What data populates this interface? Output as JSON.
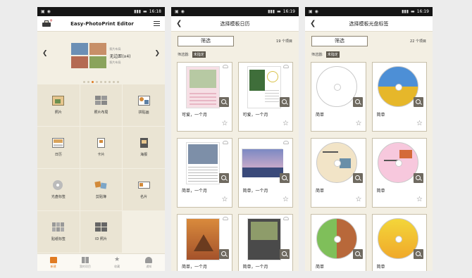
{
  "status": {
    "screens": [
      {
        "time": "16:18"
      },
      {
        "time": "16:19"
      },
      {
        "time": "16:19"
      }
    ]
  },
  "home": {
    "title": "Easy-PhotoPrint Editor",
    "banner": {
      "small_top": "照片布局",
      "main": "无边距(x4)",
      "small_bottom": "照片布局"
    },
    "dots_count": 9,
    "tiles": [
      {
        "label": "照片",
        "icon": "photo-icon"
      },
      {
        "label": "照片布局",
        "icon": "photo-layout-icon"
      },
      {
        "label": "拼贴画",
        "icon": "collage-icon"
      },
      {
        "label": "日历",
        "icon": "calendar-icon"
      },
      {
        "label": "卡片",
        "icon": "card-icon"
      },
      {
        "label": "海报",
        "icon": "poster-icon"
      },
      {
        "label": "光盘标签",
        "icon": "disc-label-icon"
      },
      {
        "label": "剪贴簿",
        "icon": "scrapbook-icon"
      },
      {
        "label": "名片",
        "icon": "business-card-icon"
      },
      {
        "label": "贴纸标签",
        "icon": "sticker-icon"
      },
      {
        "label": "ID 照片",
        "icon": "id-photo-icon"
      }
    ],
    "tabs": [
      {
        "label": "新建",
        "icon": "new-icon",
        "active": true
      },
      {
        "label": "我的项目",
        "icon": "my-projects-icon",
        "active": false
      },
      {
        "label": "收藏",
        "icon": "favorites-icon",
        "active": false
      },
      {
        "label": "通知",
        "icon": "notifications-icon",
        "active": false
      }
    ]
  },
  "calendar_screen": {
    "title": "选择模板日历",
    "filter_label": "筛选",
    "count": "19 个项目",
    "filter_prefix": "筛选器:",
    "filter_value": "未指定",
    "cards": [
      {
        "label": "可爱，一个月"
      },
      {
        "label": "可爱，一个月"
      },
      {
        "label": "简单，一个月"
      },
      {
        "label": "简单，一个月"
      },
      {
        "label": "简单，一个月"
      },
      {
        "label": "简单，一个月"
      }
    ]
  },
  "disc_screen": {
    "title": "选择模板光盘标签",
    "filter_label": "筛选",
    "count": "22 个项目",
    "filter_prefix": "筛选器:",
    "filter_value": "未指定",
    "cards": [
      {
        "label": "简单"
      },
      {
        "label": "简单"
      },
      {
        "label": "简单"
      },
      {
        "label": "简单"
      },
      {
        "label": "简单"
      },
      {
        "label": "简单"
      }
    ]
  },
  "colors": {
    "accent": "#e07b22",
    "background": "#f3efe3",
    "tile": "#eae4d3"
  }
}
